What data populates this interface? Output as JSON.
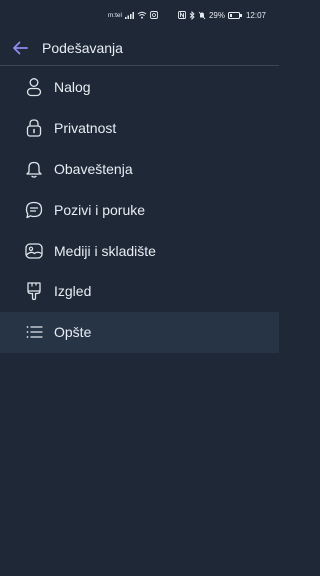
{
  "status_bar": {
    "carrier": "m:tel",
    "battery_percent": "29%",
    "battery_level": 0.29,
    "time": "12:07"
  },
  "header": {
    "title": "Podešavanja"
  },
  "menu": {
    "items": [
      {
        "label": "Nalog",
        "icon": "person-icon"
      },
      {
        "label": "Privatnost",
        "icon": "lock-icon"
      },
      {
        "label": "Obaveštenja",
        "icon": "bell-icon"
      },
      {
        "label": "Pozivi i poruke",
        "icon": "chat-icon"
      },
      {
        "label": "Mediji i skladište",
        "icon": "image-icon"
      },
      {
        "label": "Izgled",
        "icon": "brush-icon"
      },
      {
        "label": "Opšte",
        "icon": "list-icon",
        "selected": true
      }
    ]
  },
  "colors": {
    "background": "#1e2836",
    "selected_row": "#263446",
    "accent": "#8a8cf0",
    "text": "#e9eef4"
  }
}
